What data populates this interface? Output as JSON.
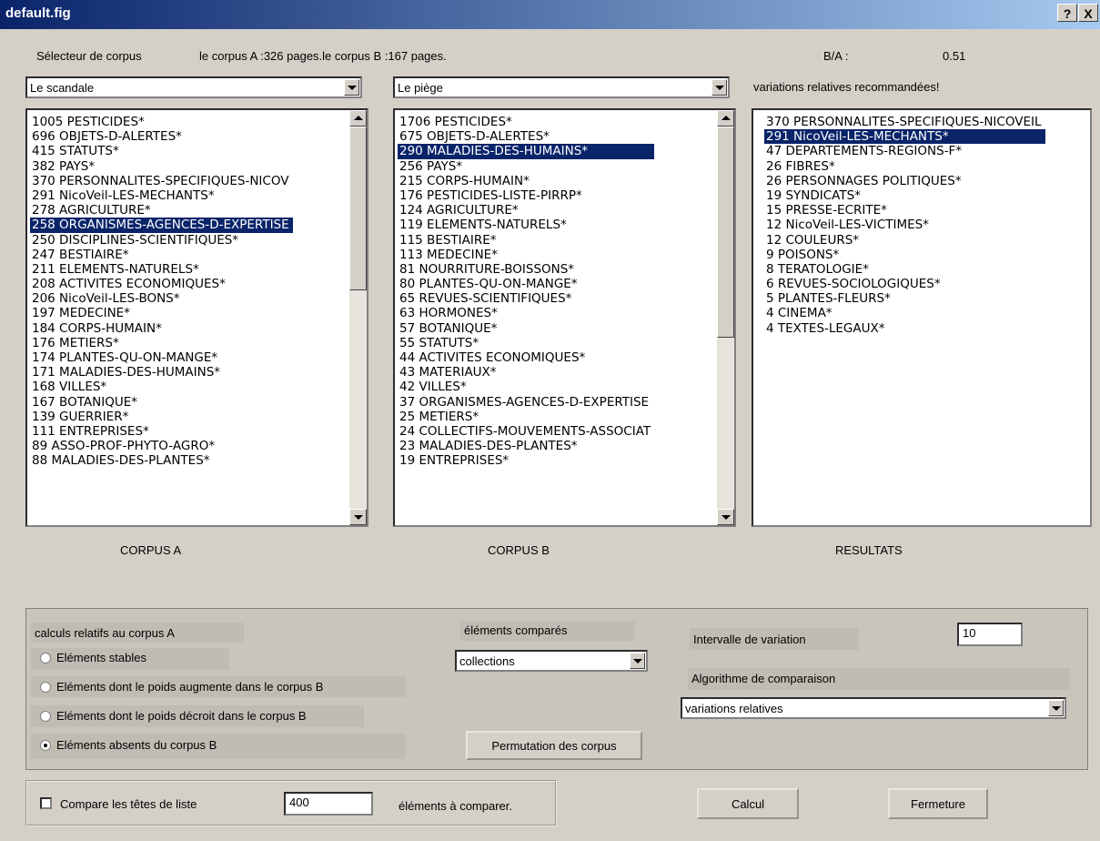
{
  "window": {
    "title": "default.fig",
    "help_button": "?",
    "close_button": "X"
  },
  "header": {
    "selector_label": "Sélecteur de corpus",
    "pages_info": "le corpus A :326 pages.le corpus B :167 pages.",
    "ratio_label": "B/A :",
    "ratio_value": "0.51",
    "recommendation": "variations relatives recommandées!"
  },
  "corpus_a": {
    "selected": "Le scandale",
    "caption": "CORPUS A",
    "items": [
      "1005 PESTICIDES*",
      "696 OBJETS-D-ALERTES*",
      "415 STATUTS*",
      "382 PAYS*",
      "370 PERSONNALITES-SPECIFIQUES-NICOV",
      "291 NicoVeil-LES-MECHANTS*",
      "278 AGRICULTURE*",
      "258 ORGANISMES-AGENCES-D-EXPERTISE",
      "250 DISCIPLINES-SCIENTIFIQUES*",
      "247 BESTIAIRE*",
      "211 ELEMENTS-NATURELS*",
      "208 ACTIVITES ECONOMIQUES*",
      "206 NicoVeil-LES-BONS*",
      "197 MEDECINE*",
      "184 CORPS-HUMAIN*",
      "176 METIERS*",
      "174 PLANTES-QU-ON-MANGE*",
      "171 MALADIES-DES-HUMAINS*",
      "168 VILLES*",
      "167 BOTANIQUE*",
      "139 GUERRIER*",
      "111 ENTREPRISES*",
      "89 ASSO-PROF-PHYTO-AGRO*",
      "88 MALADIES-DES-PLANTES*"
    ]
  },
  "corpus_b": {
    "selected": "Le piège",
    "caption": "CORPUS B",
    "items": [
      "1706 PESTICIDES*",
      "675 OBJETS-D-ALERTES*",
      "290 MALADIES-DES-HUMAINS*",
      "256 PAYS*",
      "215 CORPS-HUMAIN*",
      "176 PESTICIDES-LISTE-PIRRP*",
      "124 AGRICULTURE*",
      "119 ELEMENTS-NATURELS*",
      "115 BESTIAIRE*",
      "113 MEDECINE*",
      "81 NOURRITURE-BOISSONS*",
      "80 PLANTES-QU-ON-MANGE*",
      "65 REVUES-SCIENTIFIQUES*",
      "63 HORMONES*",
      "57 BOTANIQUE*",
      "55 STATUTS*",
      "44 ACTIVITES ECONOMIQUES*",
      "43 MATERIAUX*",
      "42 VILLES*",
      "37 ORGANISMES-AGENCES-D-EXPERTISE",
      "25 METIERS*",
      "24 COLLECTIFS-MOUVEMENTS-ASSOCIAT",
      "23 MALADIES-DES-PLANTES*",
      "19 ENTREPRISES*"
    ]
  },
  "results": {
    "caption": "RESULTATS",
    "items": [
      "370 PERSONNALITES-SPECIFIQUES-NICOVEIL",
      "291 NicoVeil-LES-MECHANTS*",
      "47 DEPARTEMENTS-REGIONS-F*",
      "26 FIBRES*",
      "26 PERSONNAGES POLITIQUES*",
      "19 SYNDICATS*",
      "15 PRESSE-ECRITE*",
      "12 NicoVeil-LES-VICTIMES*",
      "12 COULEURS*",
      "9 POISONS*",
      "8 TERATOLOGIE*",
      "6 REVUES-SOCIOLOGIQUES*",
      "5 PLANTES-FLEURS*",
      "4 CINEMA*",
      "4 TEXTES-LEGAUX*"
    ]
  },
  "options": {
    "group_label": "calculs relatifs au corpus A",
    "radios": [
      {
        "label": "Eléments stables",
        "checked": false
      },
      {
        "label": "Eléments dont le poids augmente dans le corpus B",
        "checked": false
      },
      {
        "label": "Eléments dont le poids décroit dans le corpus B",
        "checked": false
      },
      {
        "label": "Eléments absents du corpus B",
        "checked": true
      }
    ],
    "compared_label": "éléments comparés",
    "compared_value": "collections",
    "permute_button": "Permutation des corpus",
    "interval_label": "Intervalle de variation",
    "interval_value": "10",
    "algo_label": "Algorithme de comparaison",
    "algo_value": "variations relatives"
  },
  "footer": {
    "compare_heads_label": "Compare les têtes de liste",
    "compare_heads_checked": false,
    "count_value": "400",
    "count_suffix": "éléments à comparer.",
    "calc_button": "Calcul",
    "close_button": "Fermeture"
  }
}
